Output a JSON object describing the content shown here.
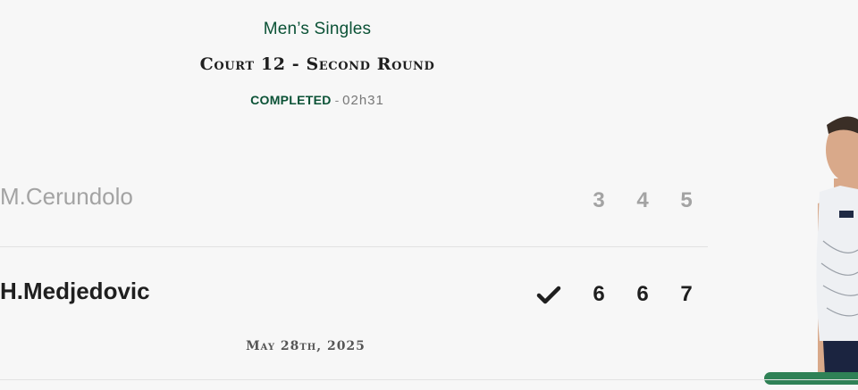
{
  "match": {
    "event": "Men’s Singles",
    "court_round": "Court 12 - Second Round",
    "status": "COMPLETED",
    "separator": "-",
    "duration": "02h31",
    "date": "May 28th, 2025"
  },
  "players": [
    {
      "name": "M.Cerundolo",
      "sets": [
        "3",
        "4",
        "5"
      ],
      "winner": false
    },
    {
      "name": "H.Medjedovic",
      "sets": [
        "6",
        "6",
        "7"
      ],
      "winner": true
    }
  ],
  "colors": {
    "accent_green": "#0b5236",
    "bar_green": "#2f8156",
    "loser_gray": "#a3a3a3",
    "text_dark": "#1f1f1f"
  },
  "icons": {
    "winner_mark": "checkmark-icon",
    "player_photo": "player-photo"
  }
}
